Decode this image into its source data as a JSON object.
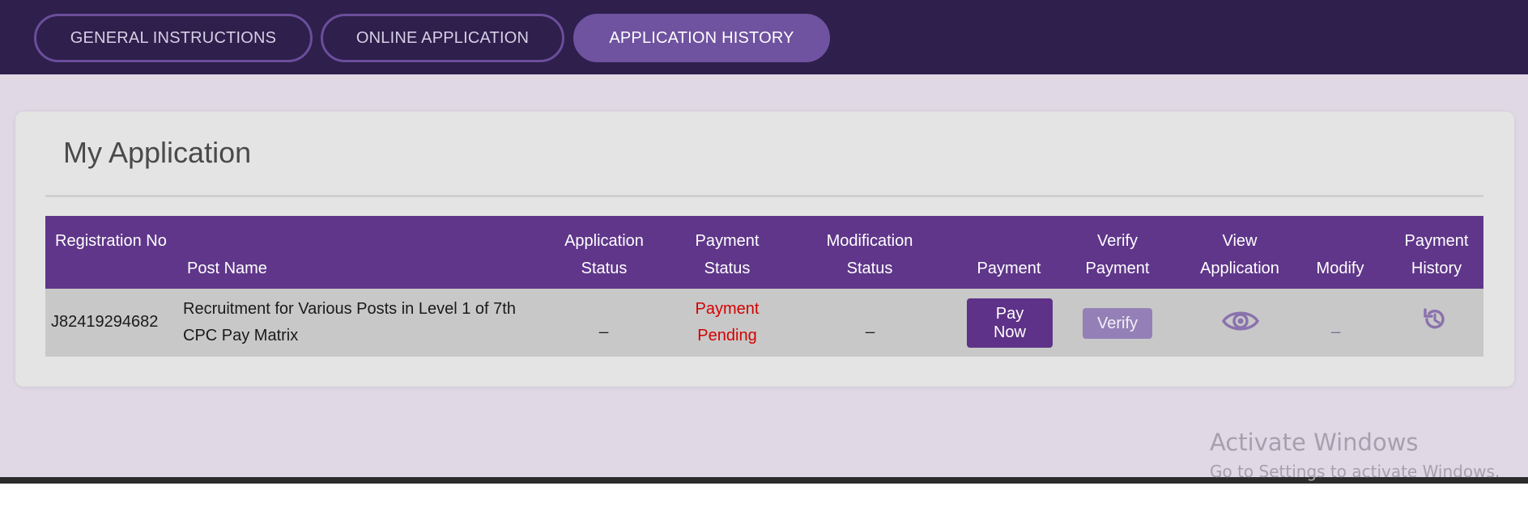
{
  "nav": {
    "tabs": [
      {
        "label": "GENERAL INSTRUCTIONS",
        "active": false
      },
      {
        "label": "ONLINE APPLICATION",
        "active": false
      },
      {
        "label": "APPLICATION HISTORY",
        "active": true
      }
    ]
  },
  "card": {
    "title": "My Application"
  },
  "table": {
    "headers": [
      "Registration No",
      "Post Name",
      "Application Status",
      "Payment Status",
      "Modification Status",
      "Payment",
      "Verify Payment",
      "View Application",
      "Modify",
      "Payment History"
    ],
    "rows": [
      {
        "registration_no": "J82419294682",
        "post_name": "Recruitment for Various Posts in Level 1 of 7th CPC Pay Matrix",
        "application_status": "_",
        "payment_status": "Payment Pending",
        "modification_status": "_",
        "payment_button": "Pay Now",
        "verify_button": "Verify",
        "view_application_icon": "eye-icon",
        "modify": "_",
        "payment_history_icon": "history-icon"
      }
    ]
  },
  "watermark": {
    "title": "Activate Windows",
    "subtitle": "Go to Settings to activate Windows."
  },
  "colors": {
    "top_bar": "#2e1f4c",
    "accent": "#5f368a",
    "active_tab": "#6f52a0",
    "pending": "#d40000",
    "content_bg": "#e0d8e4"
  }
}
